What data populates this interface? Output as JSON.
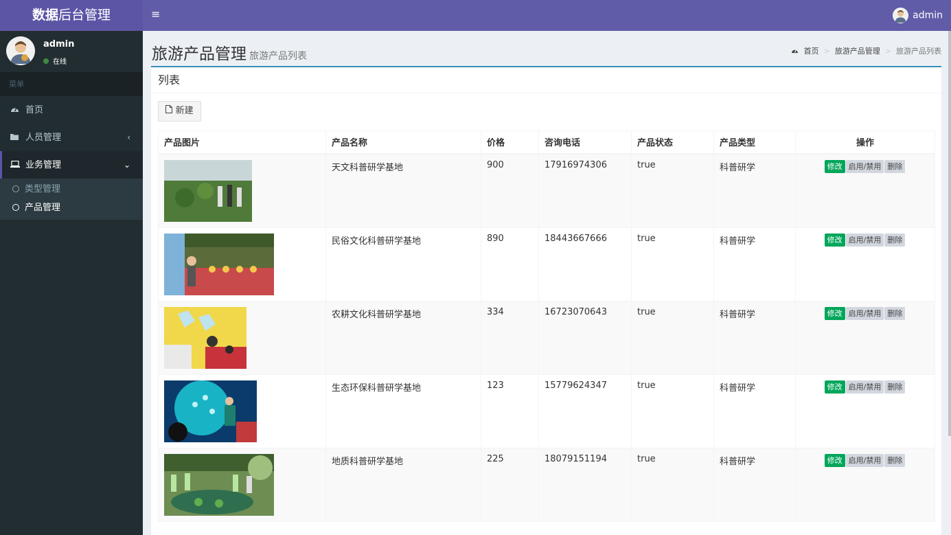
{
  "app": {
    "title_bold": "数据",
    "title_rest": "后台管理"
  },
  "sidebar": {
    "user_name": "admin",
    "user_status": "在线",
    "menu_header": "菜单",
    "items": [
      {
        "label": "首页",
        "icon": "dashboard-icon"
      },
      {
        "label": "人员管理",
        "icon": "folder-icon"
      },
      {
        "label": "业务管理",
        "icon": "laptop-icon"
      }
    ],
    "subitems": [
      {
        "label": "类型管理"
      },
      {
        "label": "产品管理"
      }
    ]
  },
  "topbar": {
    "menu_toggle": "≡",
    "user_name": "admin"
  },
  "page": {
    "title": "旅游产品管理",
    "subtitle": "旅游产品列表",
    "breadcrumb": [
      "首页",
      "旅游产品管理",
      "旅游产品列表"
    ]
  },
  "box": {
    "title": "列表",
    "new_button": "新建"
  },
  "table": {
    "headers": [
      "产品图片",
      "产品名称",
      "价格",
      "咨询电话",
      "产品状态",
      "产品类型",
      "操作"
    ],
    "rows": [
      {
        "name": "天文科普研学基地",
        "price": "900",
        "phone": "17916974306",
        "status": "true",
        "type": "科普研学"
      },
      {
        "name": "民俗文化科普研学基地",
        "price": "890",
        "phone": "18443667666",
        "status": "true",
        "type": "科普研学"
      },
      {
        "name": "农耕文化科普研学基地",
        "price": "334",
        "phone": "16723070643",
        "status": "true",
        "type": "科普研学"
      },
      {
        "name": "生态环保科普研学基地",
        "price": "123",
        "phone": "15779624347",
        "status": "true",
        "type": "科普研学"
      },
      {
        "name": "地质科普研学基地",
        "price": "225",
        "phone": "18079151194",
        "status": "true",
        "type": "科普研学"
      }
    ],
    "actions": {
      "edit": "修改",
      "toggle": "启用/禁用",
      "delete": "删除"
    }
  },
  "colors": {
    "brand": "#605ca8",
    "sidebar": "#222d32",
    "edit": "#00a65a"
  }
}
